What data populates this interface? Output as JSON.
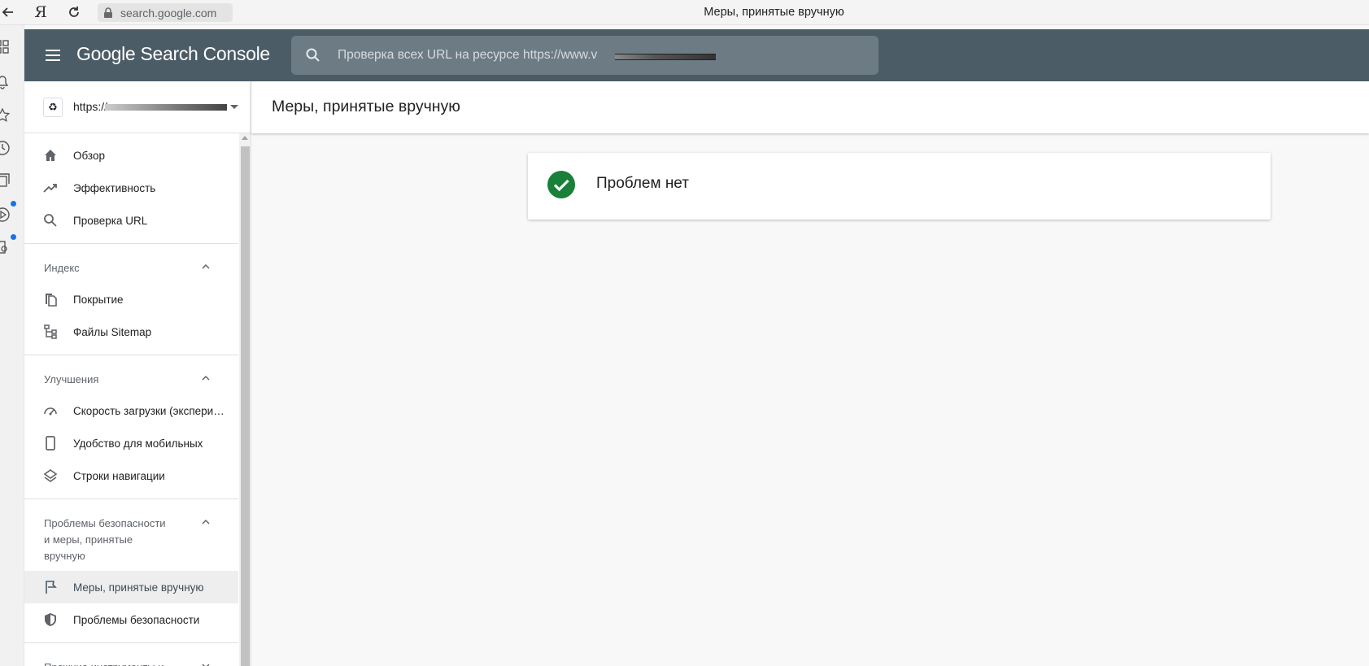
{
  "browser": {
    "address": "search.google.com",
    "tab_title": "Меры, принятые вручную",
    "yandex_logo": "Я"
  },
  "header": {
    "brand": "Google Search Console",
    "search_placeholder": "Проверка всех URL на ресурсе https://www.v"
  },
  "property": {
    "url": "https://"
  },
  "sidebar": {
    "top_items": [
      {
        "label": "Обзор",
        "icon": "home-icon"
      },
      {
        "label": "Эффективность",
        "icon": "trending-up-icon"
      },
      {
        "label": "Проверка URL",
        "icon": "search-icon"
      }
    ],
    "sections": [
      {
        "title": "Индекс",
        "items": [
          {
            "label": "Покрытие",
            "icon": "file-copy-icon"
          },
          {
            "label": "Файлы Sitemap",
            "icon": "sitemap-icon"
          }
        ]
      },
      {
        "title": "Улучшения",
        "items": [
          {
            "label": "Скорость загрузки (экспериментальный отчет)",
            "icon": "speed-icon"
          },
          {
            "label": "Удобство для мобильных",
            "icon": "mobile-icon"
          },
          {
            "label": "Строки навигации",
            "icon": "layers-icon"
          }
        ]
      },
      {
        "title": "Проблемы безопасности и меры, принятые вручную",
        "items": [
          {
            "label": "Меры, принятые вручную",
            "icon": "flag-icon"
          },
          {
            "label": "Проблемы безопасности",
            "icon": "shield-icon"
          }
        ]
      },
      {
        "title": "Прежние инструменты и"
      }
    ]
  },
  "main": {
    "title": "Меры, принятые вручную",
    "status_text": "Проблем нет",
    "status_color": "#188038"
  },
  "colors": {
    "header_bg": "#4b5c66",
    "accent": "#1a73e8"
  }
}
